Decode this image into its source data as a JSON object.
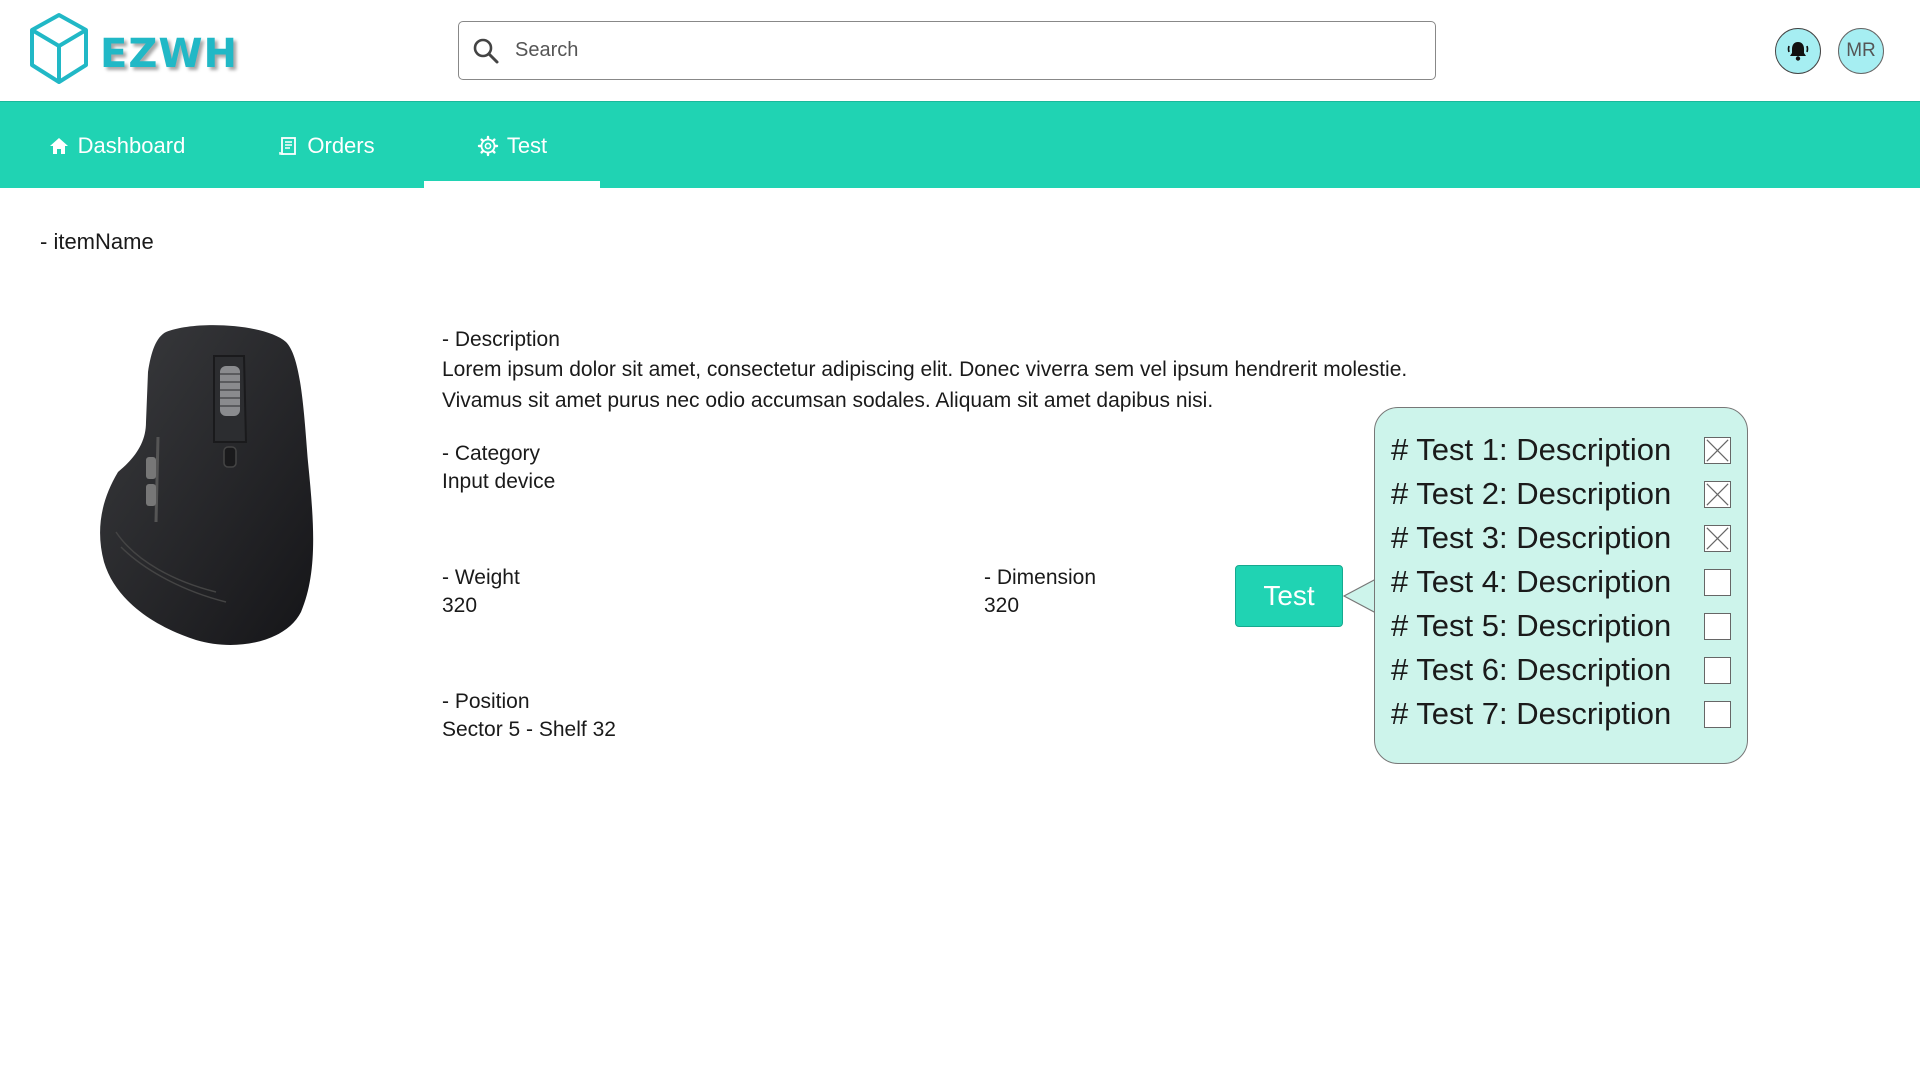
{
  "app": {
    "name": "EZWH"
  },
  "search": {
    "placeholder": "Search"
  },
  "user": {
    "initials": "MR"
  },
  "nav": {
    "tabs": [
      {
        "label": "Dashboard",
        "icon": "home-icon",
        "active": false
      },
      {
        "label": "Orders",
        "icon": "receipt-icon",
        "active": false
      },
      {
        "label": "Test",
        "icon": "gear-icon",
        "active": true
      }
    ]
  },
  "item": {
    "name_label": "- itemName",
    "description_label": "- Description",
    "description_line1": "Lorem ipsum dolor sit amet, consectetur adipiscing elit. Donec viverra sem vel ipsum hendrerit molestie.",
    "description_line2": "Vivamus sit amet purus nec odio accumsan sodales. Aliquam sit amet dapibus nisi.",
    "category_label": "- Category",
    "category_value": "Input device",
    "weight_label": "- Weight",
    "weight_value": "320",
    "dimension_label": "- Dimension",
    "dimension_value": "320",
    "position_label": "- Position",
    "position_value": "Sector 5 - Shelf 32"
  },
  "test_button": {
    "label": "Test"
  },
  "tests": [
    {
      "label": "# Test 1: Description",
      "checked": true
    },
    {
      "label": "# Test 2: Description",
      "checked": true
    },
    {
      "label": "# Test 3: Description",
      "checked": true
    },
    {
      "label": "# Test 4: Description",
      "checked": false
    },
    {
      "label": "# Test 5: Description",
      "checked": false
    },
    {
      "label": "# Test 6: Description",
      "checked": false
    },
    {
      "label": "# Test 7: Description",
      "checked": false
    }
  ],
  "colors": {
    "brand": "#21b8c6",
    "nav": "#20d3b3",
    "popover": "#cdf4eb",
    "avatar_bg": "#a6eef2"
  }
}
